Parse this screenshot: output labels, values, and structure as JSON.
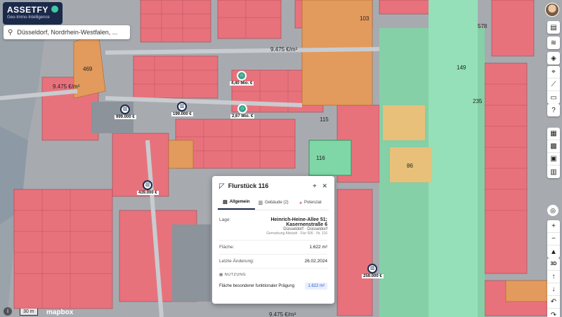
{
  "brand": {
    "name": "ASSETFY",
    "tagline": "Geo-Immo-Intelligence"
  },
  "search": {
    "value": "Düsseldorf, Nordrhein-Westfalen, ..."
  },
  "map": {
    "labels": [
      "9.475 €/m²",
      "9.475 €/m²",
      "9.475 €/m²",
      "469",
      "103",
      "578",
      "149",
      "235",
      "115",
      "86",
      "116"
    ],
    "scale": "30 m",
    "attribution": "mapbox"
  },
  "markers": [
    {
      "label": "999.000 €"
    },
    {
      "label": "199.000 €"
    },
    {
      "label": "4,40 Mio. €"
    },
    {
      "label": "2,67 Mio. €"
    },
    {
      "label": "439.000 €"
    },
    {
      "label": "259.000 €"
    }
  ],
  "panel": {
    "title": "Flurstück 116",
    "tabs": [
      {
        "label": "Allgemein"
      },
      {
        "label": "Gebäude (2)"
      },
      {
        "label": "Potenzial"
      }
    ],
    "lage_key": "Lage:",
    "lage_line1": "Heinrich-Heine-Allee 51;",
    "lage_line2": "Kasernenstraße 6",
    "lage_city": "Düsseldorf · Düsseldorf",
    "lage_detail": "Gemarkung Altstadt · Flur 006 · Nr. 116",
    "flaeche_key": "Fläche:",
    "flaeche_val": "1.622 m²",
    "aenderung_key": "Letzte Änderung:",
    "aenderung_val": "26.02.2024",
    "nutzung_title": "NUTZUNG",
    "nutzung_label": "Fläche besonderer funktionaler Prägung",
    "nutzung_val": "1.622 m²"
  },
  "colors": {
    "brand": "#1c2a4a",
    "parcel_red": "#e8727c",
    "parcel_orange": "#e39a5d",
    "green": "#7fd6a6"
  }
}
